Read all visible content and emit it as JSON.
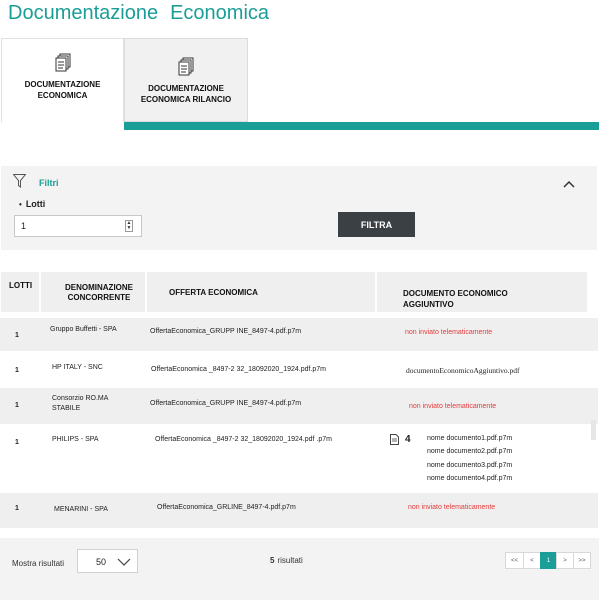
{
  "page": {
    "title_part1": "Documentazione",
    "title_part2": "Economica"
  },
  "tabs": [
    {
      "label": "DOCUMENTAZIONE\nECONOMICA",
      "icon": "document-stack-icon",
      "active": true
    },
    {
      "label": "DOCUMENTAZIONE\nECONOMICA RILANCIO",
      "icon": "document-stack-icon",
      "active": false
    }
  ],
  "filter": {
    "title": "Filtri",
    "field_label": "Lotti",
    "field_value": "1",
    "submit_label": "FILTRA"
  },
  "table": {
    "headers": {
      "lotti": "LOTTI",
      "denominazione": "DENOMINAZIONE CONCORRENTE",
      "offerta": "OFFERTA ECONOMICA",
      "documento": "DOCUMENTO ECONOMICO AGGIUNTIVO"
    },
    "rows": [
      {
        "lotti": "1",
        "denominazione": "Gruppo Buffetti - SPA",
        "offerta": "OffertaEconomica_GRUPP INE_8497-4.pdf.p7m",
        "documento": "non inviato telematicamente"
      },
      {
        "lotti": "1",
        "denominazione": "HP ITALY - SNC",
        "offerta": "OffertaEconomica _8497-2 32_18092020_1924.pdf.p7m",
        "documento": "documentoEconomicoAggiuntivo.pdf"
      },
      {
        "lotti": "1",
        "denominazione": "Consorzio RO.MA STABILE",
        "offerta": "OffertaEconomica_GRUPP INE_8497-4.pdf.p7m",
        "documento": "non inviato telematicamente"
      },
      {
        "lotti": "1",
        "denominazione": "PHILIPS - SPA",
        "offerta": "OffertaEconomica _8497-2 32_18092020_1924.pdf .p7m",
        "documento_count": "4",
        "documento_list": [
          "nome documento1.pdf.p7m",
          "nome documento2.pdf.p7m",
          "nome documento3.pdf.p7m",
          "nome documento4.pdf.p7m"
        ]
      },
      {
        "lotti": "1",
        "denominazione": "MENARINI - SPA",
        "offerta": "OffertaEconomica_GRLINE_8497-4.pdf.p7m",
        "documento": "non inviato telematicamente"
      }
    ]
  },
  "footer": {
    "page_size_label": "Mostra risultati",
    "page_size_value": "50",
    "results_count": "5",
    "results_label": "risultati",
    "pagination": [
      "<<",
      "<",
      "1",
      ">",
      ">>"
    ]
  },
  "colors": {
    "accent": "#1a9e97",
    "button_dark": "#3b4045",
    "status_red": "#e33b3b"
  }
}
